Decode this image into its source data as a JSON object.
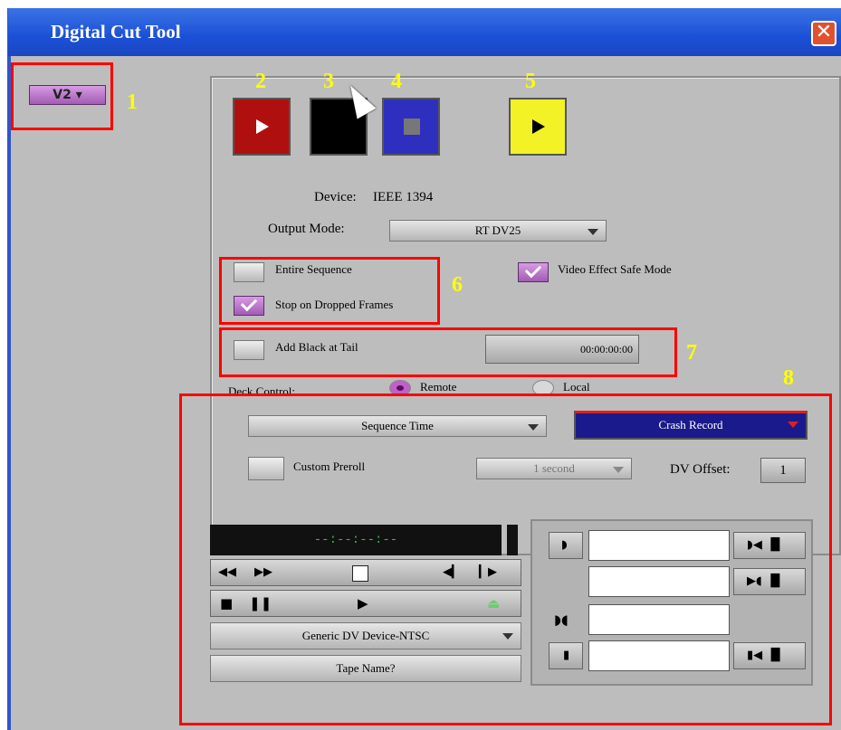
{
  "window": {
    "title": "Digital Cut Tool"
  },
  "track_button": {
    "label": "V2"
  },
  "annotations": [
    "1",
    "2",
    "3",
    "4",
    "5",
    "6",
    "7",
    "8"
  ],
  "device": {
    "label": "Device:",
    "value": "IEEE 1394"
  },
  "output_mode": {
    "label": "Output Mode:",
    "value": "RT DV25"
  },
  "options": {
    "entire_sequence": "Entire Sequence",
    "stop_on_dropped": "Stop on Dropped Frames",
    "video_effect_safe": "Video Effect Safe Mode",
    "add_black": "Add Black at Tail",
    "add_black_tc": "00:00:00:00"
  },
  "deck": {
    "label": "Deck Control:",
    "remote": "Remote",
    "local": "Local",
    "time_source": "Sequence Time",
    "record_mode": "Crash Record",
    "custom_preroll": "Custom Preroll",
    "preroll_value": "1 second",
    "dv_offset_label": "DV Offset:",
    "dv_offset_value": "1"
  },
  "deck_controller": {
    "timecode": "--:--:--:--",
    "device": "Generic DV Device-NTSC",
    "tape_name": "Tape Name?"
  },
  "colors": {
    "accent": "#a25bb4",
    "record": "#1a1a8c"
  }
}
